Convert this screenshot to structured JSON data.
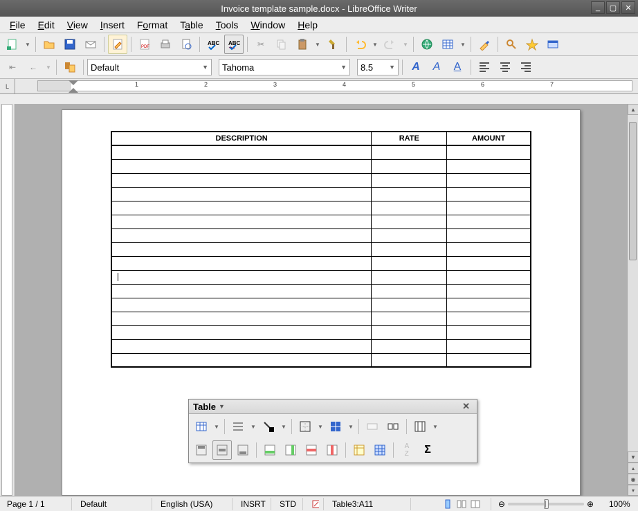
{
  "window": {
    "title": "Invoice template sample.docx - LibreOffice Writer"
  },
  "menu": {
    "file": "File",
    "edit": "Edit",
    "view": "View",
    "insert": "Insert",
    "format": "Format",
    "table": "Table",
    "tools": "Tools",
    "window": "Window",
    "help": "Help"
  },
  "formatbar": {
    "style": "Default",
    "font": "Tahoma",
    "size": "8.5"
  },
  "invoice": {
    "headers": {
      "desc": "DESCRIPTION",
      "rate": "RATE",
      "amount": "AMOUNT"
    },
    "rows": 16,
    "cursor_row": 9
  },
  "table_toolbar": {
    "title": "Table"
  },
  "status": {
    "page": "Page 1 / 1",
    "style": "Default",
    "lang": "English (USA)",
    "mode": "INSRT",
    "sel": "STD",
    "cell": "Table3:A11",
    "zoom": "100%"
  },
  "ruler": {
    "unit_marks": [
      "1",
      "2",
      "3",
      "4",
      "5",
      "6",
      "7"
    ]
  }
}
